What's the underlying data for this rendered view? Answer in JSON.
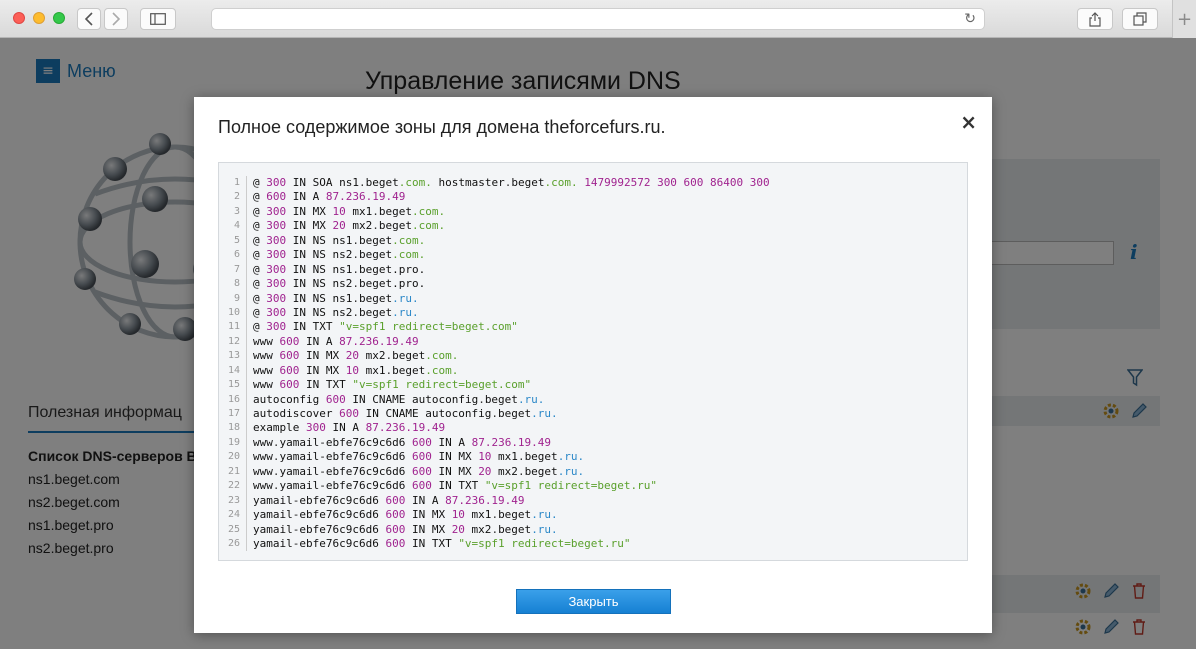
{
  "page": {
    "menu_label": "Меню",
    "title": "Управление записями DNS",
    "info_heading": "Полезная информац",
    "dns_servers_title": "Список DNS-серверов B",
    "dns_servers": [
      "ns1.beget.com",
      "ns2.beget.com",
      "ns1.beget.pro",
      "ns2.beget.pro"
    ]
  },
  "modal": {
    "title": "Полное содержимое зоны для домена theforcefurs.ru.",
    "close_symbol": "×",
    "close_button": "Закрыть",
    "lines": [
      [
        [
          "@ ",
          "p"
        ],
        [
          "300",
          "n"
        ],
        [
          " IN SOA ns1",
          "p"
        ],
        [
          ".",
          "d"
        ],
        [
          "beget",
          "p"
        ],
        [
          ".com.",
          "t"
        ],
        [
          " hostmaster",
          "p"
        ],
        [
          ".",
          "d"
        ],
        [
          "beget",
          "p"
        ],
        [
          ".com.",
          "t"
        ],
        [
          " ",
          "p"
        ],
        [
          "1479992572 300 600 86400 300",
          "n"
        ]
      ],
      [
        [
          "@ ",
          "p"
        ],
        [
          "600",
          "n"
        ],
        [
          " IN A ",
          "p"
        ],
        [
          "87.236.19.49",
          "n"
        ]
      ],
      [
        [
          "@ ",
          "p"
        ],
        [
          "300",
          "n"
        ],
        [
          " IN MX ",
          "p"
        ],
        [
          "10",
          "n"
        ],
        [
          " mx1",
          "p"
        ],
        [
          ".",
          "d"
        ],
        [
          "beget",
          "p"
        ],
        [
          ".com.",
          "t"
        ]
      ],
      [
        [
          "@ ",
          "p"
        ],
        [
          "300",
          "n"
        ],
        [
          " IN MX ",
          "p"
        ],
        [
          "20",
          "n"
        ],
        [
          " mx2",
          "p"
        ],
        [
          ".",
          "d"
        ],
        [
          "beget",
          "p"
        ],
        [
          ".com.",
          "t"
        ]
      ],
      [
        [
          "@ ",
          "p"
        ],
        [
          "300",
          "n"
        ],
        [
          " IN NS ns1",
          "p"
        ],
        [
          ".",
          "d"
        ],
        [
          "beget",
          "p"
        ],
        [
          ".com.",
          "t"
        ]
      ],
      [
        [
          "@ ",
          "p"
        ],
        [
          "300",
          "n"
        ],
        [
          " IN NS ns2",
          "p"
        ],
        [
          ".",
          "d"
        ],
        [
          "beget",
          "p"
        ],
        [
          ".com.",
          "t"
        ]
      ],
      [
        [
          "@ ",
          "p"
        ],
        [
          "300",
          "n"
        ],
        [
          " IN NS ns1",
          "p"
        ],
        [
          ".",
          "d"
        ],
        [
          "beget",
          "p"
        ],
        [
          ".pro.",
          "p"
        ]
      ],
      [
        [
          "@ ",
          "p"
        ],
        [
          "300",
          "n"
        ],
        [
          " IN NS ns2",
          "p"
        ],
        [
          ".",
          "d"
        ],
        [
          "beget",
          "p"
        ],
        [
          ".pro.",
          "p"
        ]
      ],
      [
        [
          "@ ",
          "p"
        ],
        [
          "300",
          "n"
        ],
        [
          " IN NS ns1",
          "p"
        ],
        [
          ".",
          "d"
        ],
        [
          "beget",
          "p"
        ],
        [
          ".ru.",
          "r"
        ]
      ],
      [
        [
          "@ ",
          "p"
        ],
        [
          "300",
          "n"
        ],
        [
          " IN NS ns2",
          "p"
        ],
        [
          ".",
          "d"
        ],
        [
          "beget",
          "p"
        ],
        [
          ".ru.",
          "r"
        ]
      ],
      [
        [
          "@ ",
          "p"
        ],
        [
          "300",
          "n"
        ],
        [
          " IN TXT ",
          "p"
        ],
        [
          "\"v=spf1 redirect=beget.com\"",
          "s"
        ]
      ],
      [
        [
          "www ",
          "p"
        ],
        [
          "600",
          "n"
        ],
        [
          " IN A ",
          "p"
        ],
        [
          "87.236.19.49",
          "n"
        ]
      ],
      [
        [
          "www ",
          "p"
        ],
        [
          "600",
          "n"
        ],
        [
          " IN MX ",
          "p"
        ],
        [
          "20",
          "n"
        ],
        [
          " mx2",
          "p"
        ],
        [
          ".",
          "d"
        ],
        [
          "beget",
          "p"
        ],
        [
          ".com.",
          "t"
        ]
      ],
      [
        [
          "www ",
          "p"
        ],
        [
          "600",
          "n"
        ],
        [
          " IN MX ",
          "p"
        ],
        [
          "10",
          "n"
        ],
        [
          " mx1",
          "p"
        ],
        [
          ".",
          "d"
        ],
        [
          "beget",
          "p"
        ],
        [
          ".com.",
          "t"
        ]
      ],
      [
        [
          "www ",
          "p"
        ],
        [
          "600",
          "n"
        ],
        [
          " IN TXT ",
          "p"
        ],
        [
          "\"v=spf1 redirect=beget.com\"",
          "s"
        ]
      ],
      [
        [
          "autoconfig ",
          "p"
        ],
        [
          "600",
          "n"
        ],
        [
          " IN CNAME autoconfig",
          "p"
        ],
        [
          ".",
          "d"
        ],
        [
          "beget",
          "p"
        ],
        [
          ".ru.",
          "r"
        ]
      ],
      [
        [
          "autodiscover ",
          "p"
        ],
        [
          "600",
          "n"
        ],
        [
          " IN CNAME autoconfig",
          "p"
        ],
        [
          ".",
          "d"
        ],
        [
          "beget",
          "p"
        ],
        [
          ".ru.",
          "r"
        ]
      ],
      [
        [
          "example ",
          "p"
        ],
        [
          "300",
          "n"
        ],
        [
          " IN A ",
          "p"
        ],
        [
          "87.236.19.49",
          "n"
        ]
      ],
      [
        [
          "www",
          "p"
        ],
        [
          ".",
          "d"
        ],
        [
          "yamail-ebfe76c9c6d6 ",
          "p"
        ],
        [
          "600",
          "n"
        ],
        [
          " IN A ",
          "p"
        ],
        [
          "87.236.19.49",
          "n"
        ]
      ],
      [
        [
          "www",
          "p"
        ],
        [
          ".",
          "d"
        ],
        [
          "yamail-ebfe76c9c6d6 ",
          "p"
        ],
        [
          "600",
          "n"
        ],
        [
          " IN MX ",
          "p"
        ],
        [
          "10",
          "n"
        ],
        [
          " mx1",
          "p"
        ],
        [
          ".",
          "d"
        ],
        [
          "beget",
          "p"
        ],
        [
          ".ru.",
          "r"
        ]
      ],
      [
        [
          "www",
          "p"
        ],
        [
          ".",
          "d"
        ],
        [
          "yamail-ebfe76c9c6d6 ",
          "p"
        ],
        [
          "600",
          "n"
        ],
        [
          " IN MX ",
          "p"
        ],
        [
          "20",
          "n"
        ],
        [
          " mx2",
          "p"
        ],
        [
          ".",
          "d"
        ],
        [
          "beget",
          "p"
        ],
        [
          ".ru.",
          "r"
        ]
      ],
      [
        [
          "www",
          "p"
        ],
        [
          ".",
          "d"
        ],
        [
          "yamail-ebfe76c9c6d6 ",
          "p"
        ],
        [
          "600",
          "n"
        ],
        [
          " IN TXT ",
          "p"
        ],
        [
          "\"v=spf1 redirect=beget.ru\"",
          "s"
        ]
      ],
      [
        [
          "yamail-ebfe76c9c6d6 ",
          "p"
        ],
        [
          "600",
          "n"
        ],
        [
          " IN A ",
          "p"
        ],
        [
          "87.236.19.49",
          "n"
        ]
      ],
      [
        [
          "yamail-ebfe76c9c6d6 ",
          "p"
        ],
        [
          "600",
          "n"
        ],
        [
          " IN MX ",
          "p"
        ],
        [
          "10",
          "n"
        ],
        [
          " mx1",
          "p"
        ],
        [
          ".",
          "d"
        ],
        [
          "beget",
          "p"
        ],
        [
          ".ru.",
          "r"
        ]
      ],
      [
        [
          "yamail-ebfe76c9c6d6 ",
          "p"
        ],
        [
          "600",
          "n"
        ],
        [
          " IN MX ",
          "p"
        ],
        [
          "20",
          "n"
        ],
        [
          " mx2",
          "p"
        ],
        [
          ".",
          "d"
        ],
        [
          "beget",
          "p"
        ],
        [
          ".ru.",
          "r"
        ]
      ],
      [
        [
          "yamail-ebfe76c9c6d6 ",
          "p"
        ],
        [
          "600",
          "n"
        ],
        [
          " IN TXT ",
          "p"
        ],
        [
          "\"v=spf1 redirect=beget.ru\"",
          "s"
        ]
      ]
    ]
  },
  "colors": {
    "accent": "#1a7bbf",
    "number": "#a0238f",
    "string": "#5aa02c",
    "tld_ru": "#2b88c8"
  },
  "icons": {
    "back": "chevron-left-icon",
    "forward": "chevron-right-icon",
    "sidebar": "sidebar-icon",
    "reload": "reload-icon",
    "share": "share-icon",
    "tabs": "tabs-icon",
    "new_tab": "plus-icon",
    "menu": "hamburger-icon",
    "info": "info-icon",
    "filter": "filter-icon",
    "settings": "gear-icon",
    "edit": "pencil-icon",
    "delete": "trash-icon",
    "close": "close-icon"
  }
}
